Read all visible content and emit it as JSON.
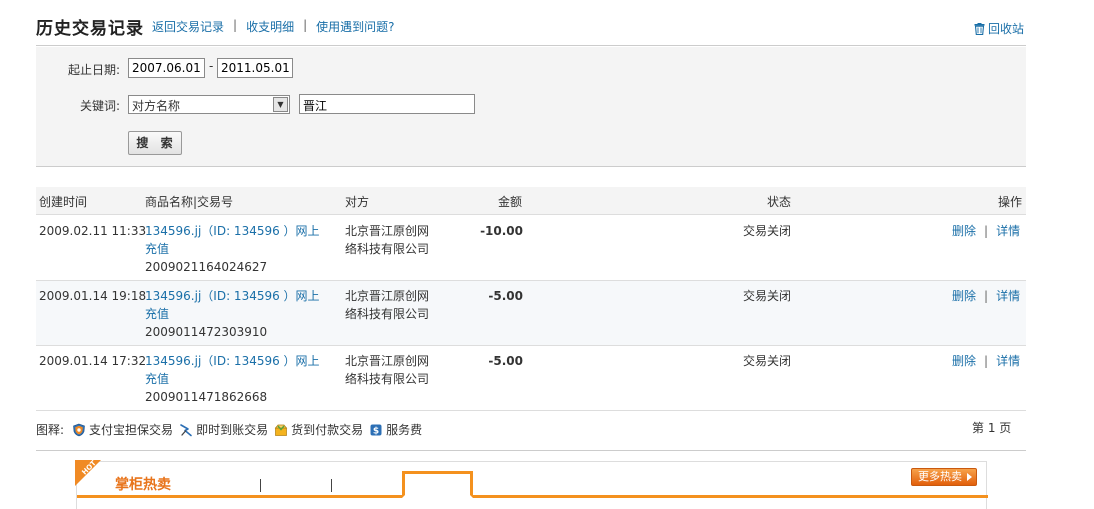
{
  "header": {
    "title": "历史交易记录",
    "links": [
      "返回交易记录",
      "收支明细",
      "使用遇到问题?"
    ],
    "recycle": "回收站"
  },
  "filter": {
    "date_label": "起止日期:",
    "date_from": "2007.06.01",
    "date_dash": "-",
    "date_to": "2011.05.01",
    "keyword_label": "关键词:",
    "keyword_type": "对方名称",
    "keyword_value": "晋江",
    "search_button": "搜 索"
  },
  "table": {
    "headers": {
      "time": "创建时间",
      "item": "商品名称|交易号",
      "party": "对方",
      "amount": "金额",
      "status": "状态",
      "ops": "操作"
    },
    "rows": [
      {
        "time": "2009.02.11 11:33",
        "item_name": "134596.jj（ID: 134596 ）网上充值",
        "trade_no": "2009021164024627",
        "party": "北京晋江原创网络科技有限公司",
        "amount": "-10.00",
        "status": "交易关闭",
        "delete": "删除",
        "detail": "详情"
      },
      {
        "time": "2009.01.14 19:18",
        "item_name": "134596.jj（ID: 134596 ）网上充值",
        "trade_no": "2009011472303910",
        "party": "北京晋江原创网络科技有限公司",
        "amount": "-5.00",
        "status": "交易关闭",
        "delete": "删除",
        "detail": "详情"
      },
      {
        "time": "2009.01.14 17:32",
        "item_name": "134596.jj（ID: 134596 ）网上充值",
        "trade_no": "2009011471862668",
        "party": "北京晋江原创网络科技有限公司",
        "amount": "-5.00",
        "status": "交易关闭",
        "delete": "删除",
        "detail": "详情"
      }
    ]
  },
  "legend": {
    "label": "图释:",
    "items": [
      "支付宝担保交易",
      "即时到账交易",
      "货到付款交易",
      "服务费"
    ]
  },
  "pager": "第 1 页",
  "hot": {
    "badge": "HOT",
    "title": "掌柜热卖",
    "more": "更多热卖"
  },
  "colors": {
    "link": "#1a6fa8",
    "accent": "#f4911e"
  }
}
